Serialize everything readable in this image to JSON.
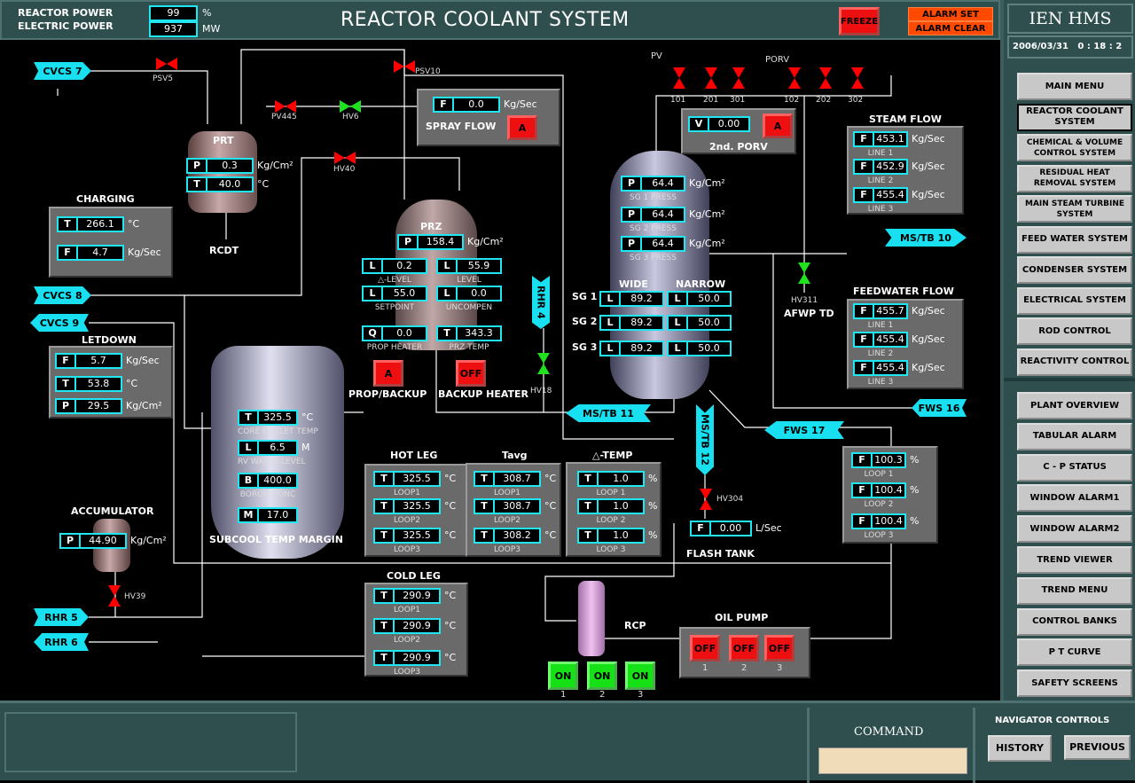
{
  "header": {
    "reactor_power_label": "REACTOR POWER",
    "reactor_power_value": "99",
    "reactor_power_unit": "%",
    "electric_power_label": "ELECTRIC POWER",
    "electric_power_value": "937",
    "electric_power_unit": "MW",
    "title": "REACTOR COOLANT SYSTEM",
    "freeze": "FREEZE",
    "alarm_set": "ALARM SET",
    "alarm_clear": "ALARM CLEAR"
  },
  "brand": {
    "name": "IEN HMS",
    "date": "2006/03/31",
    "time": "0 : 18 : 2"
  },
  "nav": {
    "items": [
      "MAIN MENU",
      "REACTOR COOLANT SYSTEM",
      "CHEMICAL & VOLUME CONTROL SYSTEM",
      "RESIDUAL HEAT REMOVAL SYSTEM",
      "MAIN STEAM TURBINE SYSTEM",
      "FEED WATER SYSTEM",
      "CONDENSER SYSTEM",
      "ELECTRICAL SYSTEM",
      "ROD CONTROL",
      "REACTIVITY CONTROL"
    ],
    "selected": "REACTOR COOLANT SYSTEM",
    "items2": [
      "PLANT OVERVIEW",
      "TABULAR ALARM",
      "C - P STATUS",
      "WINDOW ALARM1",
      "WINDOW ALARM2",
      "TREND VIEWER",
      "TREND MENU",
      "CONTROL BANKS",
      "P T CURVE",
      "SAFETY SCREENS"
    ]
  },
  "bottom": {
    "command": "COMMAND",
    "command_value": "",
    "navigator_controls": "NAVIGATOR CONTROLS",
    "history": "HISTORY",
    "previous": "PREVIOUS"
  },
  "tags": {
    "cvcs7": "CVCS 7",
    "cvcs8": "CVCS 8",
    "cvcs9": "CVCS 9",
    "rhr5": "RHR 5",
    "rhr6": "RHR 6",
    "rhr4": "RHR 4",
    "mstb11": "MS/TB 11",
    "mstb12": "MS/TB 12",
    "mstb10": "MS/TB 10",
    "fws16": "FWS 16",
    "fws17": "FWS 17"
  },
  "labels": {
    "prt": "PRT",
    "rcdt": "RCDT",
    "prz": "PRZ",
    "charging": "CHARGING",
    "letdown": "LETDOWN",
    "accumulator": "ACCUMULATOR",
    "subcool": "SUBCOOL TEMP MARGIN",
    "hot_leg": "HOT LEG",
    "tavg": "Tavg",
    "delta_temp": "△-TEMP",
    "cold_leg": "COLD LEG",
    "rcp": "RCP",
    "oil_pump": "OIL PUMP",
    "flash_tank": "FLASH TANK",
    "afwp": "AFWP TD",
    "steam_flow": "STEAM FLOW",
    "feedwater_flow": "FEEDWATER FLOW",
    "spray_flow": "SPRAY FLOW",
    "porv2": "2nd. PORV",
    "wide": "WIDE",
    "narrow": "NARROW",
    "sg1": "SG 1",
    "sg2": "SG 2",
    "sg3": "SG 3",
    "prop_backup": "PROP/BACKUP",
    "backup_heater": "BACKUP HEATER",
    "pv": "PV",
    "porv": "PORV"
  },
  "valves": [
    {
      "id": "PSV5",
      "color": "#ff0000"
    },
    {
      "id": "PV445",
      "color": "#ff0000"
    },
    {
      "id": "HV6",
      "color": "#20e020"
    },
    {
      "id": "HV40",
      "color": "#ff0000"
    },
    {
      "id": "PSV10",
      "color": "#ff0000"
    },
    {
      "id": "HV18",
      "color": "#20e020"
    },
    {
      "id": "HV311",
      "color": "#20e020"
    },
    {
      "id": "HV304",
      "color": "#ff0000"
    },
    {
      "id": "HV39",
      "color": "#ff0000"
    },
    {
      "id": "101",
      "color": "#ff0000"
    },
    {
      "id": "201",
      "color": "#ff0000"
    },
    {
      "id": "301",
      "color": "#ff0000"
    },
    {
      "id": "102",
      "color": "#ff0000"
    },
    {
      "id": "202",
      "color": "#ff0000"
    },
    {
      "id": "302",
      "color": "#ff0000"
    }
  ],
  "buttons": {
    "spray": "A",
    "porv2": "A",
    "prop_backup": "A",
    "backup_heater": "OFF",
    "oil_pumps": [
      "OFF",
      "OFF",
      "OFF"
    ],
    "oil_pump_nums": [
      "1",
      "2",
      "3"
    ],
    "rcps": [
      "ON",
      "ON",
      "ON"
    ],
    "rcp_nums": [
      "1",
      "2",
      "3"
    ]
  },
  "readouts": {
    "prt": [
      {
        "tag": "P",
        "value": "0.3",
        "unit": "Kg/Cm²"
      },
      {
        "tag": "T",
        "value": "40.0",
        "unit": "°C"
      }
    ],
    "charging": [
      {
        "tag": "T",
        "value": "266.1",
        "unit": "°C"
      },
      {
        "tag": "F",
        "value": "4.7",
        "unit": "Kg/Sec"
      }
    ],
    "letdown": [
      {
        "tag": "F",
        "value": "5.7",
        "unit": "Kg/Sec"
      },
      {
        "tag": "T",
        "value": "53.8",
        "unit": "°C"
      },
      {
        "tag": "P",
        "value": "29.5",
        "unit": "Kg/Cm²"
      }
    ],
    "accumulator": [
      {
        "tag": "P",
        "value": "44.90",
        "unit": "Kg/Cm²"
      }
    ],
    "spray": [
      {
        "tag": "F",
        "value": "0.0",
        "unit": "Kg/Sec"
      }
    ],
    "prz": [
      {
        "tag": "P",
        "value": "158.4",
        "unit": "Kg/Cm²"
      },
      {
        "tag": "L",
        "value": "0.2",
        "label": "△-LEVEL"
      },
      {
        "tag": "L",
        "value": "55.9",
        "label": "LEVEL"
      },
      {
        "tag": "L",
        "value": "55.0",
        "label": "SETPOINT"
      },
      {
        "tag": "L",
        "value": "0.0",
        "label": "UNCOMPEN"
      },
      {
        "tag": "Q",
        "value": "0.0",
        "label": "PROP HEATER"
      },
      {
        "tag": "T",
        "value": "343.3",
        "label": "PRZ TEMP"
      }
    ],
    "vessel": [
      {
        "tag": "T",
        "value": "325.5",
        "unit": "°C",
        "label": "CORE OUTLET TEMP"
      },
      {
        "tag": "L",
        "value": "6.5",
        "unit": "M",
        "label": "RV WATER LEVEL"
      },
      {
        "tag": "B",
        "value": "400.0",
        "label": "BORON CONC"
      },
      {
        "tag": "M",
        "value": "17.0"
      }
    ],
    "hot_leg": [
      {
        "tag": "T",
        "value": "325.5",
        "unit": "°C",
        "label": "LOOP1"
      },
      {
        "tag": "T",
        "value": "325.5",
        "unit": "°C",
        "label": "LOOP2"
      },
      {
        "tag": "T",
        "value": "325.5",
        "unit": "°C",
        "label": "LOOP3"
      }
    ],
    "tavg": [
      {
        "tag": "T",
        "value": "308.7",
        "unit": "°C",
        "label": "LOOP1"
      },
      {
        "tag": "T",
        "value": "308.7",
        "unit": "°C",
        "label": "LOOP2"
      },
      {
        "tag": "T",
        "value": "308.2",
        "unit": "°C",
        "label": "LOOP3"
      }
    ],
    "delta_temp": [
      {
        "tag": "T",
        "value": "1.0",
        "unit": "%",
        "label": "LOOP 1"
      },
      {
        "tag": "T",
        "value": "1.0",
        "unit": "%",
        "label": "LOOP 2"
      },
      {
        "tag": "T",
        "value": "1.0",
        "unit": "%",
        "label": "LOOP 3"
      }
    ],
    "cold_leg": [
      {
        "tag": "T",
        "value": "290.9",
        "unit": "°C",
        "label": "LOOP1"
      },
      {
        "tag": "T",
        "value": "290.9",
        "unit": "°C",
        "label": "LOOP2"
      },
      {
        "tag": "T",
        "value": "290.9",
        "unit": "°C",
        "label": "LOOP3"
      }
    ],
    "porv2": [
      {
        "tag": "V",
        "value": "0.00"
      }
    ],
    "sg_press": [
      {
        "tag": "P",
        "value": "64.4",
        "unit": "Kg/Cm²",
        "label": "SG 1 PRESS"
      },
      {
        "tag": "P",
        "value": "64.4",
        "unit": "Kg/Cm²",
        "label": "SG 2 PRESS"
      },
      {
        "tag": "P",
        "value": "64.4",
        "unit": "Kg/Cm²",
        "label": "SG 3 PRESS"
      }
    ],
    "sg_wide": [
      {
        "tag": "L",
        "value": "89.2"
      },
      {
        "tag": "L",
        "value": "89.2"
      },
      {
        "tag": "L",
        "value": "89.2"
      }
    ],
    "sg_narrow": [
      {
        "tag": "L",
        "value": "50.0"
      },
      {
        "tag": "L",
        "value": "50.0"
      },
      {
        "tag": "L",
        "value": "50.0"
      }
    ],
    "steam_flow": [
      {
        "tag": "F",
        "value": "453.1",
        "unit": "Kg/Sec",
        "label": "LINE 1"
      },
      {
        "tag": "F",
        "value": "452.9",
        "unit": "Kg/Sec",
        "label": "LINE 2"
      },
      {
        "tag": "F",
        "value": "455.4",
        "unit": "Kg/Sec",
        "label": "LINE 3"
      }
    ],
    "feedwater_flow": [
      {
        "tag": "F",
        "value": "455.7",
        "unit": "Kg/Sec",
        "label": "LINE 1"
      },
      {
        "tag": "F",
        "value": "455.4",
        "unit": "Kg/Sec",
        "label": "LINE 2"
      },
      {
        "tag": "F",
        "value": "455.4",
        "unit": "Kg/Sec",
        "label": "LINE 3"
      }
    ],
    "fws_loop": [
      {
        "tag": "F",
        "value": "100.3",
        "unit": "%",
        "label": "LOOP 1"
      },
      {
        "tag": "F",
        "value": "100.4",
        "unit": "%",
        "label": "LOOP 2"
      },
      {
        "tag": "F",
        "value": "100.4",
        "unit": "%",
        "label": "LOOP 3"
      }
    ],
    "flash": [
      {
        "tag": "F",
        "value": "0.00",
        "unit": "L/Sec"
      }
    ]
  }
}
